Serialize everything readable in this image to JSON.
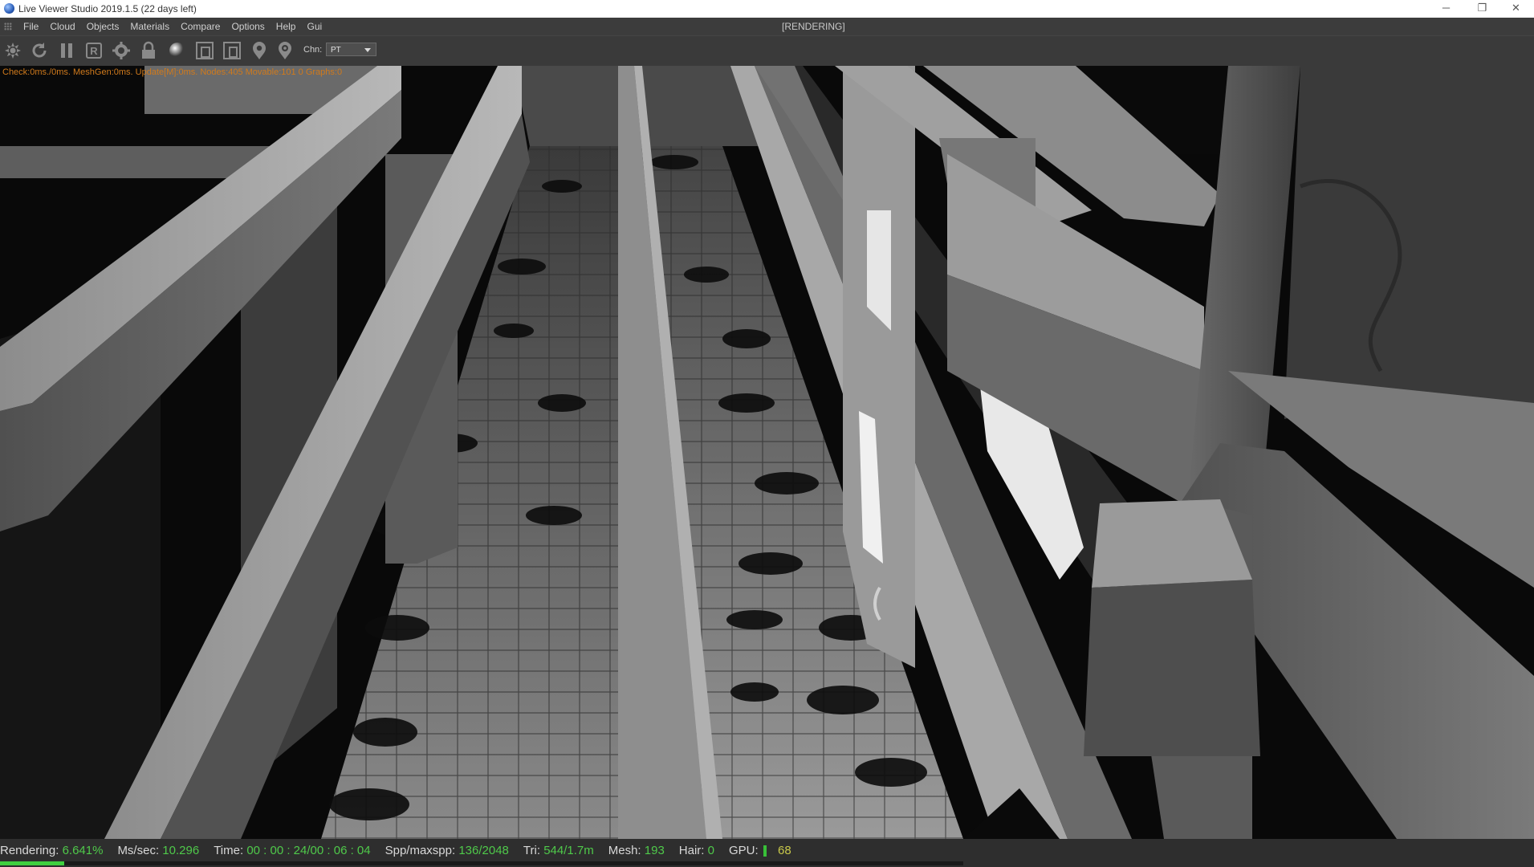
{
  "window": {
    "title": "Live Viewer Studio 2019.1.5 (22 days left)",
    "minimize": "─",
    "restore": "❐",
    "close": "✕"
  },
  "menu": {
    "items": [
      "File",
      "Cloud",
      "Objects",
      "Materials",
      "Compare",
      "Options",
      "Help",
      "Gui"
    ],
    "render_state": "[RENDERING]"
  },
  "toolbar": {
    "icons": [
      "send-scene-icon",
      "restart-render-icon",
      "pause-icon",
      "render-region-icon",
      "settings-gear-icon",
      "lock-icon",
      "material-sphere-icon",
      "camera-frame-icon",
      "film-region-icon",
      "pick-focus-icon",
      "pick-material-icon"
    ],
    "channel_label": "Chn:",
    "channel_value": "PT"
  },
  "viewport": {
    "debug_text": "Check:0ms./0ms. MeshGen:0ms. Update[M]:0ms. Nodes:405 Movable:101 0 Graphs:0"
  },
  "status": {
    "rendering_label": "Rendering:",
    "rendering_value": "6.641%",
    "ms_label": "Ms/sec:",
    "ms_value": "10.296",
    "time_label": "Time:",
    "time_value": "00 : 00 : 24/00 : 06 : 04",
    "spp_label": "Spp/maxspp:",
    "spp_value": "136/2048",
    "tri_label": "Tri:",
    "tri_value": "544/1.7m",
    "mesh_label": "Mesh:",
    "mesh_value": "193",
    "hair_label": "Hair:",
    "hair_value": "0",
    "gpu_label": "GPU:",
    "gpu_value": "68",
    "progress_fraction": 0.06641
  },
  "colors": {
    "accent_green": "#4fc94a",
    "debug_orange": "#d07a1c"
  }
}
